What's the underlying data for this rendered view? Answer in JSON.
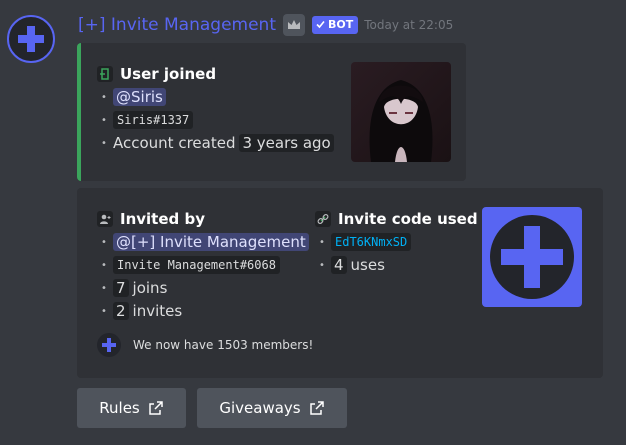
{
  "message": {
    "author": "[+] Invite Management",
    "bot_tag": "BOT",
    "timestamp": "Today at 22:05"
  },
  "embed_joined": {
    "title": "User joined",
    "mention": "@Siris",
    "tag": "Siris#1337",
    "created_prefix": "Account created",
    "created_value": "3 years ago"
  },
  "embed_invite": {
    "invited_by_title": "Invited by",
    "inviter_mention": "@[+] Invite Management",
    "inviter_tag": "Invite Management#6068",
    "joins_count": "7",
    "joins_label": "joins",
    "invites_count": "2",
    "invites_label": "invites",
    "code_title": "Invite code used",
    "code": "EdT6KNmxSD",
    "uses_count": "4",
    "uses_label": "uses",
    "footer": "We now have 1503 members!"
  },
  "buttons": {
    "rules": "Rules",
    "giveaways": "Giveaways"
  },
  "colors": {
    "blurple": "#5865f2",
    "green_accent": "#3ba55c",
    "link": "#00b0f4"
  },
  "icons": {
    "avatar": "plus-cross-icon",
    "crown": "crown-icon",
    "check": "check-icon",
    "join": "door-enter-icon",
    "invited_by": "person-add-icon",
    "invite_code": "link-icon",
    "external": "external-link-icon"
  }
}
